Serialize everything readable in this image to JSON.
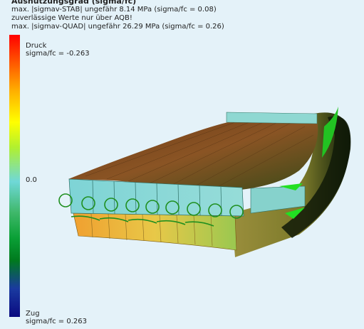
{
  "header": {
    "title": "Ausnutzungsgrad (sigma/fc)",
    "line1": "max. |sigmav-STAB| ungefähr 8.14 MPa (sigma/fc = 0.08)",
    "line2": "zuverlässige Werte nur über AQB!",
    "line3": "max. |sigmav-QUAD| ungefähr 26.29 MPa (sigma/fc = 0.26)"
  },
  "legend": {
    "top_label": "Druck",
    "top_value": "sigma/fc = -0.263",
    "mid_value": "0.0",
    "bottom_label": "Zug",
    "bottom_value": "sigma/fc = 0.263"
  },
  "colors": {
    "background": "#e4f2f9",
    "beam_top": "#7a4a1e",
    "slab_face": "#7fd6d8",
    "slab_lower": "#e8a43a",
    "arrow_green": "#22c222"
  }
}
